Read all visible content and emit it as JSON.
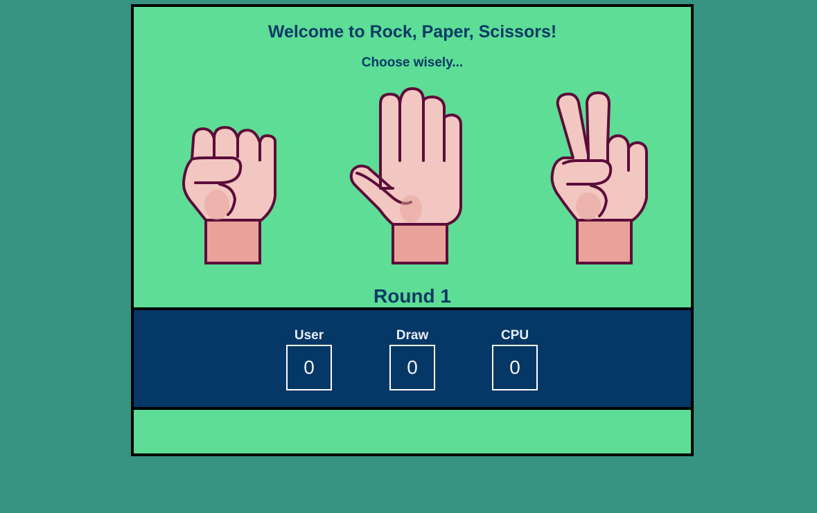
{
  "header": {
    "title": "Welcome to Rock, Paper, Scissors!",
    "subtitle": "Choose wisely..."
  },
  "choices": [
    {
      "id": "rock",
      "icon": "fist-hand-icon"
    },
    {
      "id": "paper",
      "icon": "open-hand-icon"
    },
    {
      "id": "scissors",
      "icon": "peace-hand-icon"
    }
  ],
  "round": {
    "label": "Round 1"
  },
  "scoreboard": {
    "user": {
      "label": "User",
      "value": "0"
    },
    "draw": {
      "label": "Draw",
      "value": "0"
    },
    "cpu": {
      "label": "CPU",
      "value": "0"
    }
  },
  "colors": {
    "page_background": "#389482",
    "panel_green": "#5ddd95",
    "scoreboard_navy": "#053767",
    "text_navy": "#0a3a66",
    "skin_light": "#f2c6c1",
    "skin_dark": "#e8a29a",
    "outline": "#5b0d3a"
  }
}
